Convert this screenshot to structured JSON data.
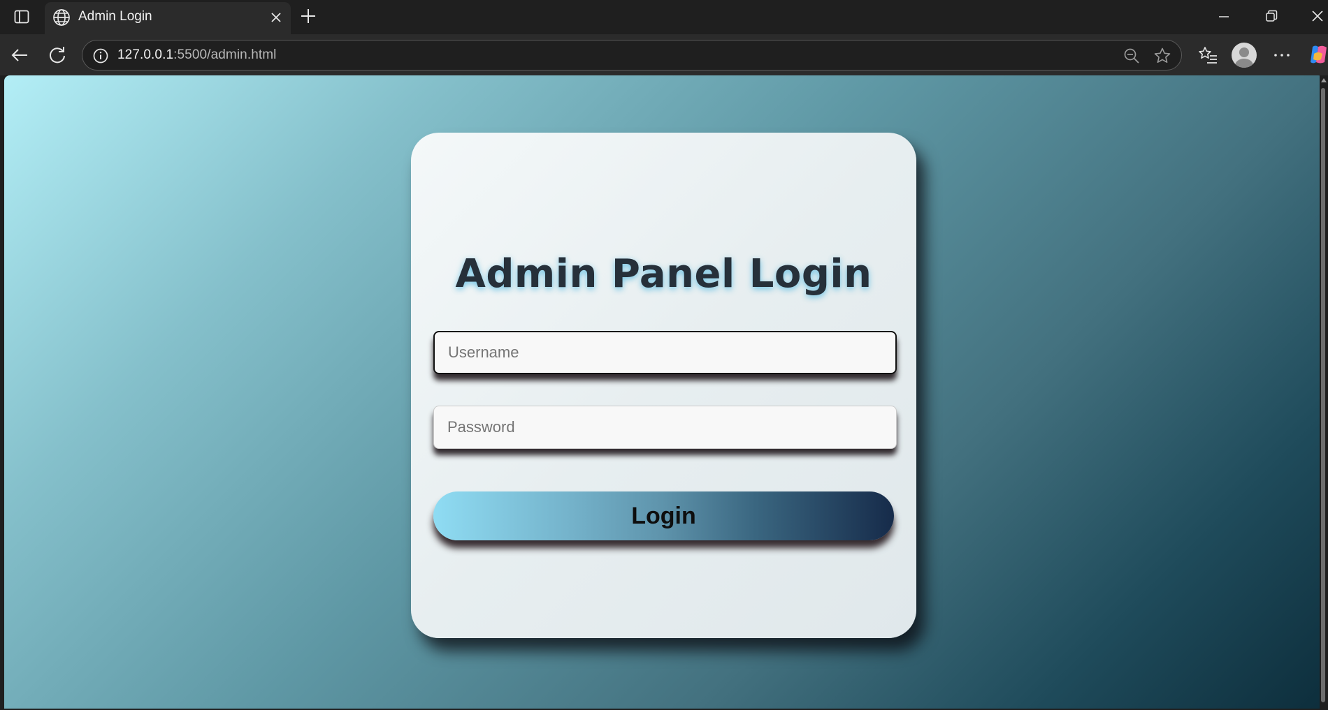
{
  "browser": {
    "tab": {
      "title": "Admin Login",
      "favicon": "globe-icon"
    },
    "address": {
      "host": "127.0.0.1",
      "rest": ":5500/admin.html"
    },
    "icons": {
      "tab_actions": "tab-actions-icon",
      "close_tab": "close-icon",
      "new_tab": "plus-icon",
      "minimize": "minimize-icon",
      "restore": "restore-icon",
      "close_window": "close-icon",
      "back": "back-arrow-icon",
      "refresh": "refresh-icon",
      "site_info": "info-icon",
      "zoom": "zoom-out-icon",
      "favorite": "star-icon",
      "favorites": "favorites-icon",
      "profile": "profile-icon",
      "more": "more-icon",
      "copilot": "copilot-icon"
    }
  },
  "page": {
    "title": "Admin Panel Login",
    "username": {
      "placeholder": "Username",
      "value": ""
    },
    "password": {
      "placeholder": "Password",
      "value": ""
    },
    "login_label": "Login"
  },
  "colors": {
    "title_glow": "#60bee2",
    "button_start": "#8fdcf3",
    "button_end": "#162b4a",
    "background_start": "#b3eef6",
    "background_end": "#0d2e3c"
  }
}
